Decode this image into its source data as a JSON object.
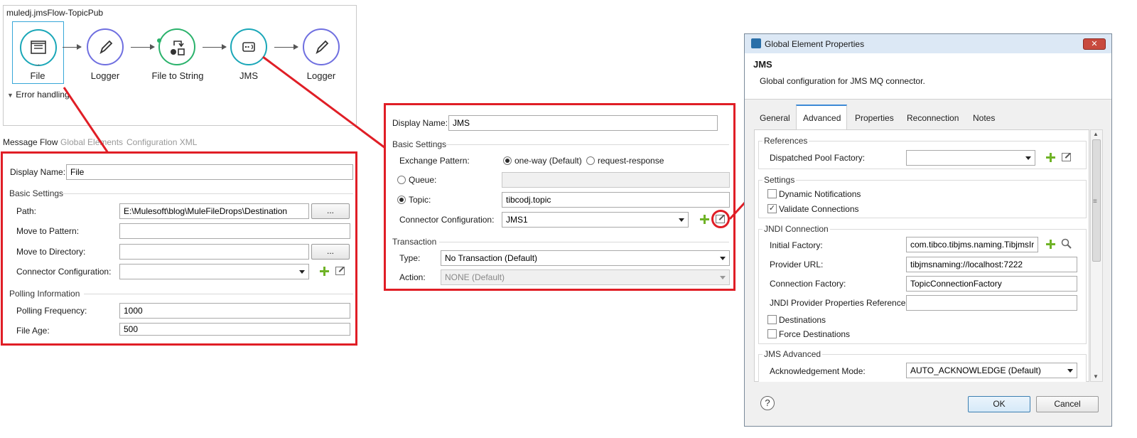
{
  "flow": {
    "title": "muledj.jmsFlow-TopicPub",
    "nodes": [
      "File",
      "Logger",
      "File to String",
      "JMS",
      "Logger"
    ],
    "error_handling": "Error handling",
    "bottom_tabs": [
      "Message Flow",
      "Global Elements",
      "Configuration XML"
    ]
  },
  "file_panel": {
    "display_name_label": "Display Name:",
    "display_name_value": "File",
    "basic_settings": "Basic Settings",
    "path_label": "Path:",
    "path_value": "E:\\Mulesoft\\blog\\MuleFileDrops\\Destination",
    "browse_label": "...",
    "move_pattern_label": "Move to Pattern:",
    "move_directory_label": "Move to Directory:",
    "connector_config_label": "Connector Configuration:",
    "polling_info": "Polling Information",
    "polling_freq_label": "Polling Frequency:",
    "polling_freq_value": "1000",
    "file_age_label": "File Age:",
    "file_age_value": "500"
  },
  "jms_panel": {
    "display_name_label": "Display Name:",
    "display_name_value": "JMS",
    "basic_settings": "Basic Settings",
    "exchange_label": "Exchange Pattern:",
    "oneway_label": "one-way (Default)",
    "reqresp_label": "request-response",
    "queue_label": "Queue:",
    "topic_label": "Topic:",
    "topic_value": "tibcodj.topic",
    "connector_config_label": "Connector Configuration:",
    "connector_config_value": "JMS1",
    "transaction": "Transaction",
    "type_label": "Type:",
    "type_value": "No Transaction (Default)",
    "action_label": "Action:",
    "action_value": "NONE (Default)"
  },
  "dialog": {
    "window_title": "Global Element Properties",
    "heading": "JMS",
    "description": "Global configuration for JMS MQ connector.",
    "tabs": [
      "General",
      "Advanced",
      "Properties",
      "Reconnection",
      "Notes"
    ],
    "active_tab": "Advanced",
    "references": "References",
    "dispatcher_label": "Dispatched Pool Factory:",
    "settings": "Settings",
    "dynamic_notifications": "Dynamic Notifications",
    "validate_connections": "Validate Connections",
    "jndi_connection": "JNDI Connection",
    "initial_factory_label": "Initial Factory:",
    "initial_factory_value": "com.tibco.tibjms.naming.TibjmsIr",
    "provider_url_label": "Provider URL:",
    "provider_url_value": "tibjmsnaming://localhost:7222",
    "connection_factory_label": "Connection Factory:",
    "connection_factory_value": "TopicConnectionFactory",
    "jndi_props_label": "JNDI Provider Properties Reference:",
    "destinations": "Destinations",
    "force_destinations": "Force Destinations",
    "jms_advanced": "JMS Advanced",
    "ack_mode_label": "Acknowledgement Mode:",
    "ack_mode_value": "AUTO_ACKNOWLEDGE (Default)",
    "help": "?",
    "ok": "OK",
    "cancel": "Cancel",
    "close": "✕"
  },
  "colors": {
    "highlight_red": "#e01e26",
    "file_teal": "#1aa7b8",
    "logger_purple": "#6f6fe0",
    "transformer_green": "#2ab26b",
    "titlebar_blue": "#dce8f5",
    "close_red": "#c84a3e"
  }
}
